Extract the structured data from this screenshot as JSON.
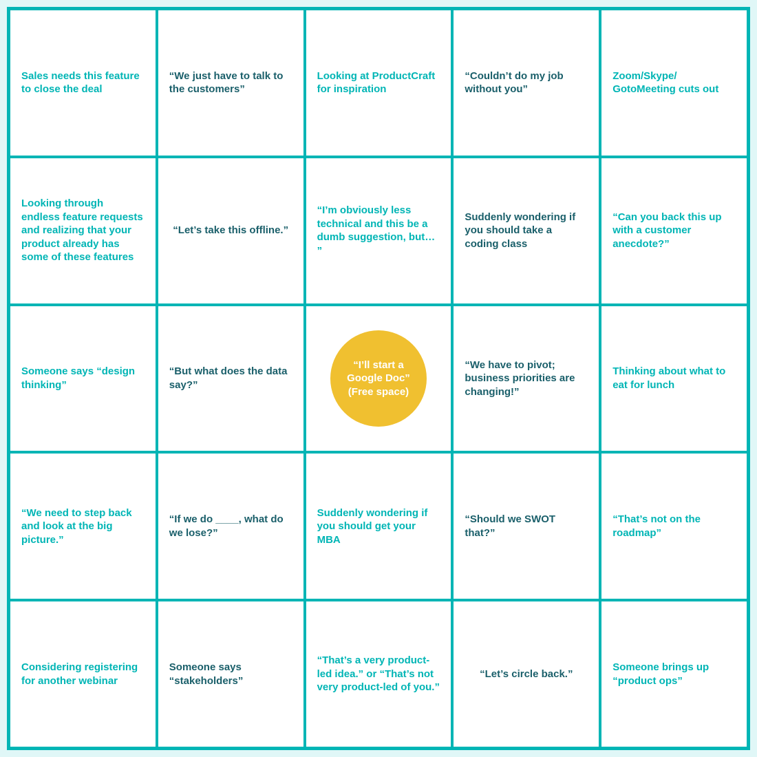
{
  "cells": [
    {
      "id": "r0c0",
      "text": "Sales needs this feature to close the deal",
      "style": "teal"
    },
    {
      "id": "r0c1",
      "text": "“We just have to talk to the customers”",
      "style": "dark"
    },
    {
      "id": "r0c2",
      "text": "Looking at ProductCraft for inspiration",
      "style": "teal"
    },
    {
      "id": "r0c3",
      "text": "“Couldn’t do my job without you”",
      "style": "dark"
    },
    {
      "id": "r0c4",
      "text": "Zoom/Skype/ GotoMeeting cuts out",
      "style": "teal"
    },
    {
      "id": "r1c0",
      "text": "Looking through endless feature requests and realizing that your product already has some of these features",
      "style": "teal"
    },
    {
      "id": "r1c1",
      "text": "“Let’s take this offline.”",
      "style": "dark"
    },
    {
      "id": "r1c2",
      "text": "“I’m obviously less technical and this be a dumb suggestion, but… ”",
      "style": "teal"
    },
    {
      "id": "r1c3",
      "text": "Suddenly wondering if you should take a coding class",
      "style": "dark"
    },
    {
      "id": "r1c4",
      "text": "“Can you back this up with a customer anecdote?”",
      "style": "teal"
    },
    {
      "id": "r2c0",
      "text": "Someone says “design thinking”",
      "style": "teal"
    },
    {
      "id": "r2c1",
      "text": "“But what does the data say?”",
      "style": "dark"
    },
    {
      "id": "r2c2",
      "text": "FREE",
      "style": "free"
    },
    {
      "id": "r2c3",
      "text": "“We have to pivot; business priorities are changing!”",
      "style": "dark"
    },
    {
      "id": "r2c4",
      "text": "Thinking about what to eat for lunch",
      "style": "teal"
    },
    {
      "id": "r3c0",
      "text": "“We need to step back and look at the big picture.”",
      "style": "teal"
    },
    {
      "id": "r3c1",
      "text": "“If we do ____, what do we lose?”",
      "style": "dark"
    },
    {
      "id": "r3c2",
      "text": "Suddenly wondering if you should get your MBA",
      "style": "teal"
    },
    {
      "id": "r3c3",
      "text": "“Should we SWOT that?”",
      "style": "dark"
    },
    {
      "id": "r3c4",
      "text": "“That’s not on the roadmap”",
      "style": "teal"
    },
    {
      "id": "r4c0",
      "text": "Considering registering for another webinar",
      "style": "teal"
    },
    {
      "id": "r4c1",
      "text": "Someone says “stakeholders”",
      "style": "dark"
    },
    {
      "id": "r4c2",
      "text": "“That’s a very product-led idea.” or “That’s not very product-led of you.”",
      "style": "teal"
    },
    {
      "id": "r4c3",
      "text": "“Let’s circle back.”",
      "style": "dark"
    },
    {
      "id": "r4c4",
      "text": "Someone brings up “product ops”",
      "style": "teal"
    }
  ],
  "free_space_label": "“I’ll start a Google Doc” (Free space)"
}
